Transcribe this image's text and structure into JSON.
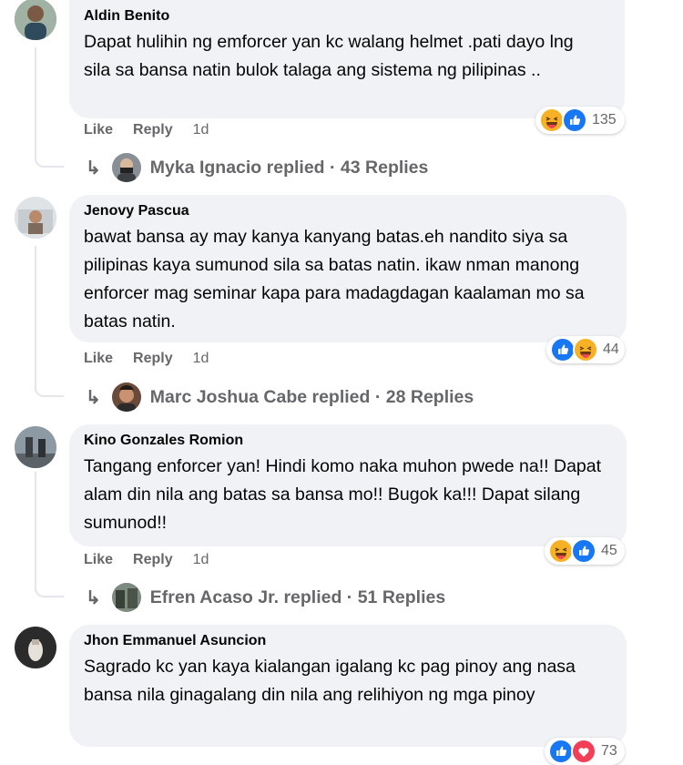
{
  "comments": [
    {
      "author": "Aldin Benito",
      "text": "Dapat hulihin ng emforcer yan kc walang helmet .pati dayo lng sila sa bansa natin bulok talaga ang sistema ng pilipinas ..",
      "like": "Like",
      "reply": "Reply",
      "time": "1d",
      "reactions": [
        "haha",
        "like"
      ],
      "reaction_count": "135",
      "replies": {
        "name": "Myka Ignacio",
        "text": "Myka Ignacio replied · 43 Replies"
      }
    },
    {
      "author": "Jenovy Pascua",
      "text": "bawat bansa ay may kanya kanyang batas.eh nandito siya sa pilipinas kaya sumunod sila sa batas natin. ikaw nman manong enforcer mag seminar kapa para madagdagan kaalaman mo sa batas natin.",
      "like": "Like",
      "reply": "Reply",
      "time": "1d",
      "reactions": [
        "like",
        "haha"
      ],
      "reaction_count": "44",
      "replies": {
        "name": "Marc Joshua Cabe",
        "text": "Marc Joshua Cabe replied · 28 Replies"
      }
    },
    {
      "author": "Kino Gonzales Romion",
      "text": "Tangang enforcer yan! Hindi komo naka muhon pwede na!! Dapat alam din nila ang batas sa bansa mo!! Bugok ka!!! Dapat silang sumunod!!",
      "like": "Like",
      "reply": "Reply",
      "time": "1d",
      "reactions": [
        "haha",
        "like"
      ],
      "reaction_count": "45",
      "replies": {
        "name": "Efren Acaso Jr.",
        "text": "Efren Acaso Jr. replied · 51 Replies"
      }
    },
    {
      "author": "Jhon Emmanuel Asuncion",
      "text": "Sagrado kc yan kaya kialangan igalang kc pag pinoy ang nasa bansa nila ginagalang din nila ang relihiyon ng mga pinoy",
      "reactions": [
        "like",
        "love"
      ],
      "reaction_count": "73"
    }
  ],
  "colors": {
    "like_blue": "#1877f2",
    "haha_yellow": "#f7b125",
    "love_red": "#f33e58",
    "bubble": "#f0f2f5",
    "meta": "#65676b"
  },
  "icons": {
    "reply_arrow": "reply-arrow-icon"
  }
}
